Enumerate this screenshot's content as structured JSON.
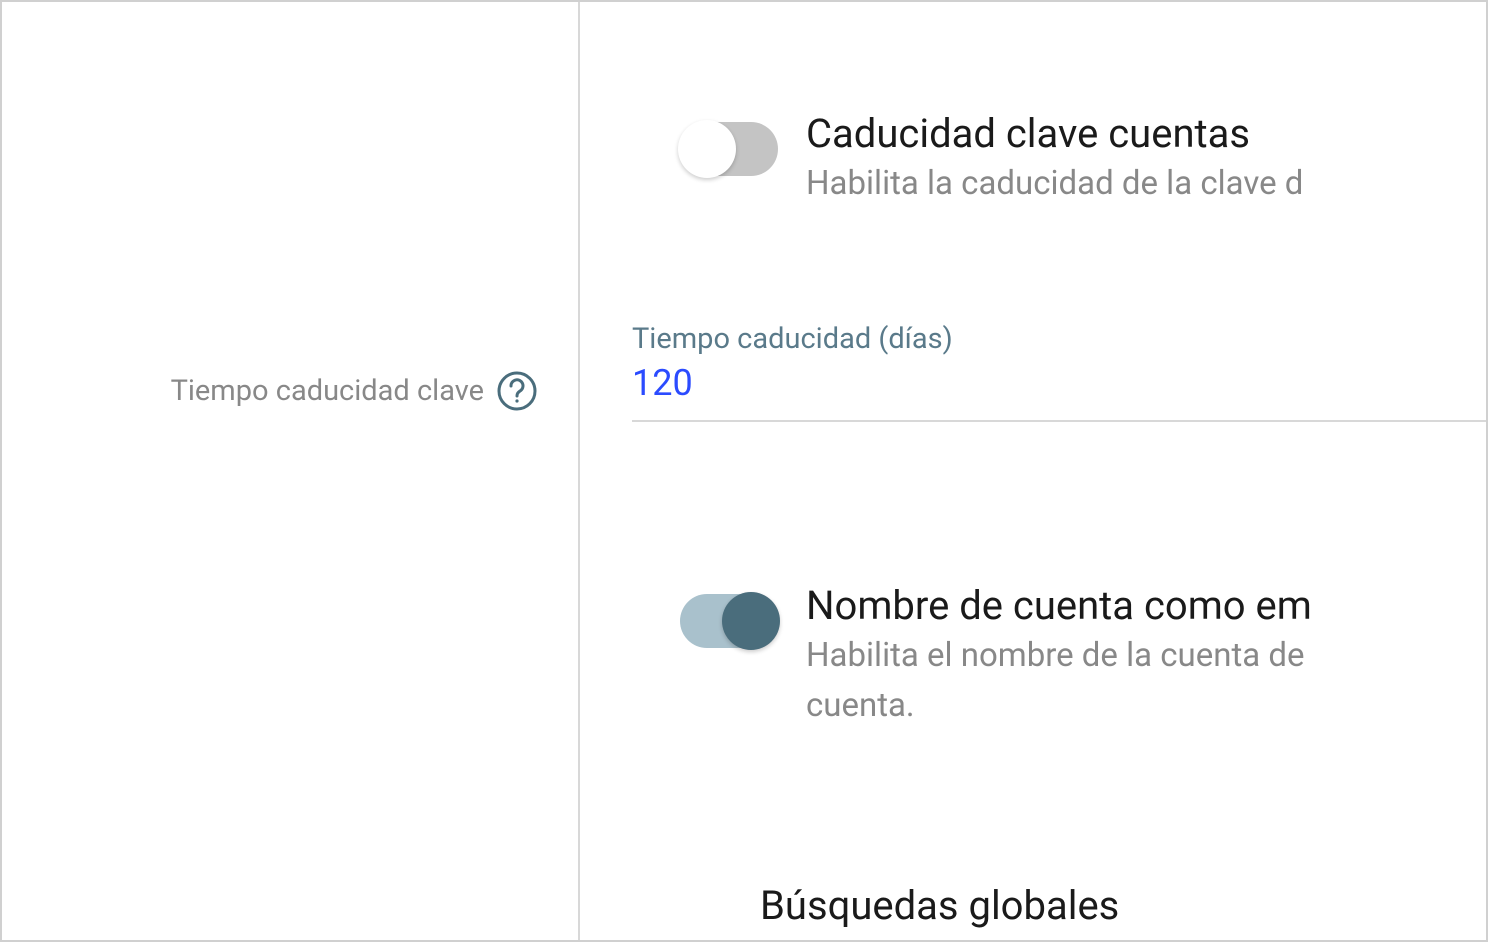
{
  "leftPanel": {
    "label": "Tiempo caducidad clave"
  },
  "settings": {
    "passwordExpiry": {
      "title": "Caducidad clave cuentas",
      "description": "Habilita la caducidad de la clave d",
      "enabled": false
    },
    "expiryField": {
      "label": "Tiempo caducidad (días)",
      "value": "120"
    },
    "accountNameEmail": {
      "title": "Nombre de cuenta como em",
      "description": "Habilita el nombre de la cuenta de",
      "description2": "cuenta.",
      "enabled": true
    },
    "globalSearch": {
      "title": "Búsquedas globales"
    }
  }
}
